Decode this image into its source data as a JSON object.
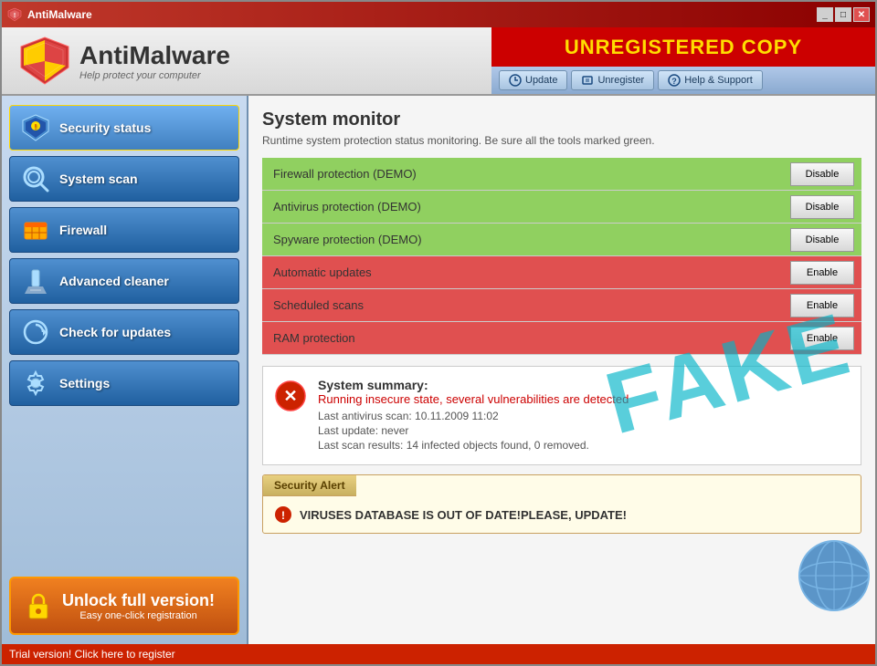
{
  "window": {
    "title": "AntiMalware",
    "controls": [
      "minimize",
      "maximize",
      "close"
    ]
  },
  "header": {
    "logo_text": "AntiMalware",
    "subtitle": "Help protect your computer",
    "unregistered": "UNREGISTERED COPY",
    "nav": [
      {
        "label": "Update",
        "icon": "update-icon"
      },
      {
        "label": "Unregister",
        "icon": "unregister-icon"
      },
      {
        "label": "Help & Support",
        "icon": "help-icon"
      }
    ]
  },
  "sidebar": {
    "items": [
      {
        "label": "Security status",
        "icon": "shield-sidebar-icon"
      },
      {
        "label": "System scan",
        "icon": "scan-icon"
      },
      {
        "label": "Firewall",
        "icon": "firewall-icon"
      },
      {
        "label": "Advanced cleaner",
        "icon": "cleaner-icon"
      },
      {
        "label": "Check for updates",
        "icon": "updates-icon"
      },
      {
        "label": "Settings",
        "icon": "settings-icon"
      }
    ],
    "unlock": {
      "title": "Unlock full version!",
      "subtitle": "Easy one-click registration"
    }
  },
  "main": {
    "section_title": "System monitor",
    "section_desc": "Runtime system protection status monitoring. Be sure all the tools marked green.",
    "monitor_rows": [
      {
        "label": "Firewall protection (DEMO)",
        "status": "green",
        "btn": "Disable"
      },
      {
        "label": "Antivirus protection (DEMO)",
        "status": "green",
        "btn": "Disable"
      },
      {
        "label": "Spyware protection (DEMO)",
        "status": "green",
        "btn": "Disable"
      },
      {
        "label": "Automatic updates",
        "status": "red",
        "btn": "Enable"
      },
      {
        "label": "Scheduled scans",
        "status": "red",
        "btn": "Enable"
      },
      {
        "label": "RAM protection",
        "status": "red",
        "btn": "Enable"
      }
    ],
    "fake_watermark": "FAKE",
    "summary": {
      "title": "System summary:",
      "alert_line": "Running insecure state, several vulnerabilities are detected",
      "lines": [
        "Last antivirus scan: 10.11.2009 11:02",
        "Last update: never",
        "Last scan results: 14 infected objects found, 0 removed."
      ]
    },
    "security_alert": {
      "tab": "Security Alert",
      "message": "VIRUSES DATABASE IS OUT OF DATE!PLEASE, UPDATE!"
    }
  },
  "status_bar": {
    "text": "Trial version! Click here to register"
  }
}
